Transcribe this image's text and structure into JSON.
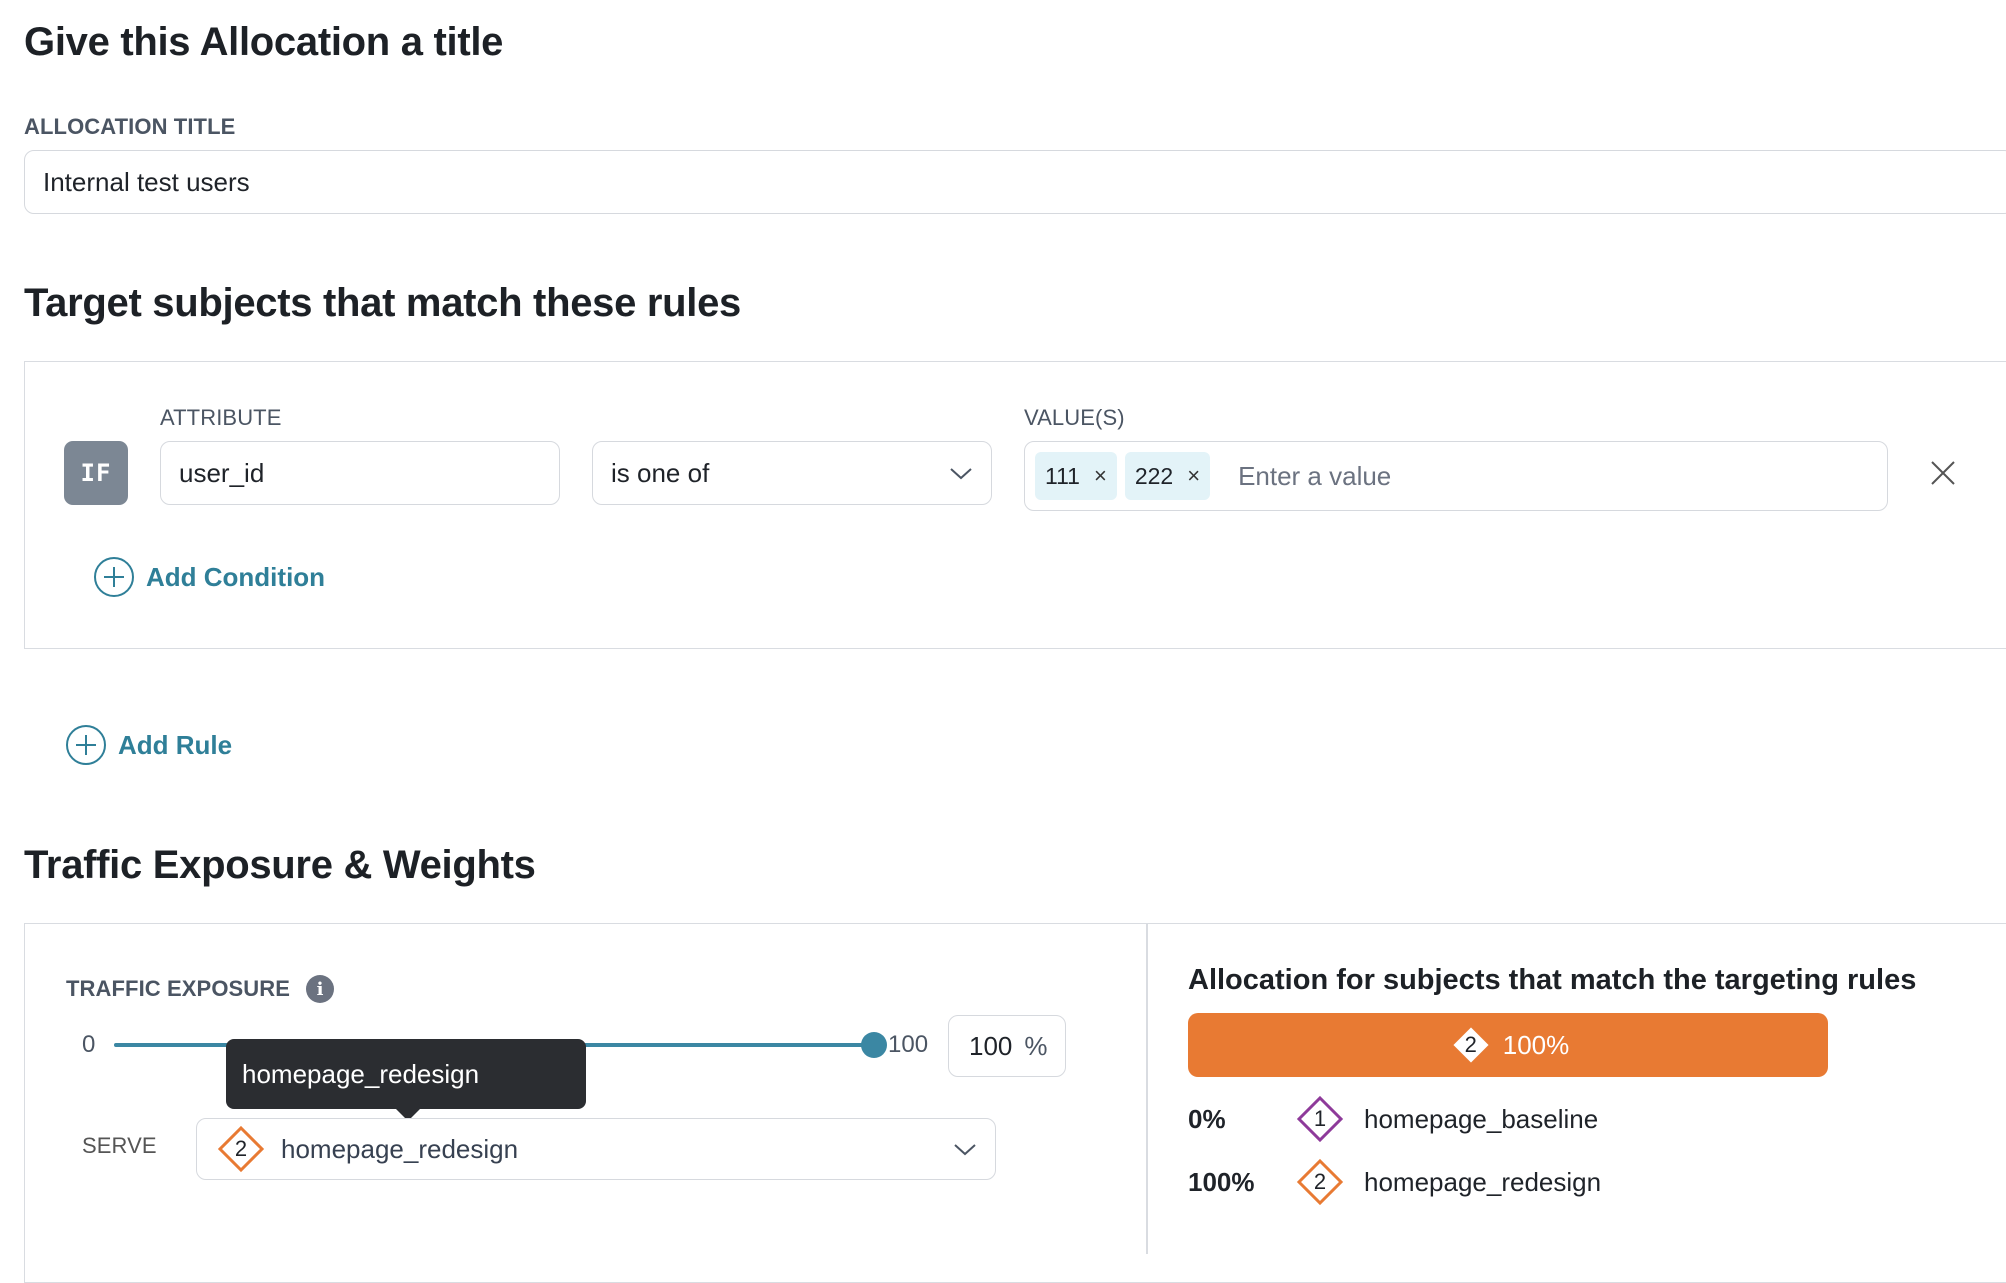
{
  "title_section": {
    "heading": "Give this Allocation a title",
    "field_label": "ALLOCATION TITLE",
    "field_value": "Internal test users"
  },
  "rules_section": {
    "heading": "Target subjects that match these rules",
    "if_label": "IF",
    "attribute_label": "ATTRIBUTE",
    "attribute_value": "user_id",
    "operator_value": "is one of",
    "values_label": "VALUE(S)",
    "value_chips": [
      "111",
      "222"
    ],
    "values_placeholder": "Enter a value",
    "chip_remove_glyph": "×",
    "add_condition": "Add Condition",
    "add_rule": "Add Rule"
  },
  "traffic_section": {
    "heading": "Traffic Exposure & Weights",
    "exposure_label": "TRAFFIC EXPOSURE",
    "slider_min": "0",
    "slider_max": "100",
    "exposure_value": 100,
    "exposure_input": "100",
    "percent_sign": "%",
    "tooltip_text": "homepage_redesign",
    "serve_label": "SERVE",
    "serve_variant_number": "2",
    "serve_variant_name": "homepage_redesign"
  },
  "allocation_summary": {
    "heading": "Allocation for subjects that match the targeting rules",
    "bar_number": "2",
    "bar_percent": "100%",
    "rows": [
      {
        "percent": "0%",
        "number": "1",
        "name": "homepage_baseline",
        "color": "#8e3a9a"
      },
      {
        "percent": "100%",
        "number": "2",
        "name": "homepage_redesign",
        "color": "#e87a33"
      }
    ]
  },
  "colors": {
    "accent_link": "#2f7f98",
    "slider": "#3b87a3",
    "variant_orange": "#e87a33",
    "variant_purple": "#8e3a9a"
  }
}
